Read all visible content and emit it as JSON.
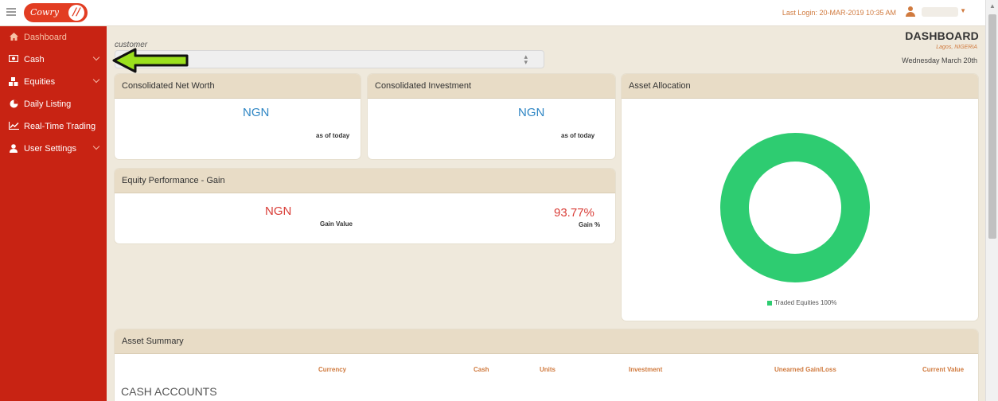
{
  "topbar": {
    "logo_text": "Cowry",
    "logo_mark": "//",
    "last_login": "Last Login: 20-MAR-2019 10:35 AM",
    "menu_icon": "hamburger-icon",
    "user_icon": "user-icon",
    "caret_icon": "chevron-down-icon"
  },
  "sidebar": {
    "bg_color": "#c82313",
    "items": [
      {
        "label": "Dashboard",
        "icon": "home-icon",
        "active": true
      },
      {
        "label": "Cash",
        "icon": "money-icon",
        "caret": true
      },
      {
        "label": "Equities",
        "icon": "cubes-icon",
        "caret": true
      },
      {
        "label": "Daily Listing",
        "icon": "pie-icon"
      },
      {
        "label": "Real-Time Trading",
        "icon": "line-chart-icon"
      },
      {
        "label": "User Settings",
        "icon": "user-icon",
        "caret": true
      }
    ]
  },
  "customer": {
    "label": "customer",
    "value": ""
  },
  "header": {
    "title": "DASHBOARD",
    "location": "Lagos, NIGERIA",
    "date": "Wednesday March 20th"
  },
  "cards": {
    "net_worth": {
      "title": "Consolidated Net Worth",
      "currency": "NGN",
      "sub": "as of today"
    },
    "investment": {
      "title": "Consolidated Investment",
      "currency": "NGN",
      "sub": "as of today"
    },
    "equity_perf": {
      "title": "Equity Performance - Gain",
      "currency": "NGN",
      "gain_value_label": "Gain Value",
      "gain_pct": "93.77%",
      "gain_pct_label": "Gain %"
    },
    "allocation": {
      "title": "Asset Allocation",
      "legend": "Traded Equities 100%"
    }
  },
  "chart_data": {
    "type": "pie",
    "categories": [
      "Traded Equities"
    ],
    "values": [
      100
    ],
    "legend": [
      "Traded Equities 100%"
    ],
    "colors": [
      "#2ecc71"
    ]
  },
  "asset_summary": {
    "title": "Asset Summary",
    "columns": [
      "Currency",
      "Cash",
      "Units",
      "Investment",
      "Unearned Gain/Loss",
      "Current Value"
    ],
    "section": "CASH ACCOUNTS"
  },
  "colors": {
    "accent_orange": "#d07a3e",
    "blue_value": "#2f86c4",
    "red_value": "#d93d37",
    "donut_green": "#2ecc71"
  }
}
